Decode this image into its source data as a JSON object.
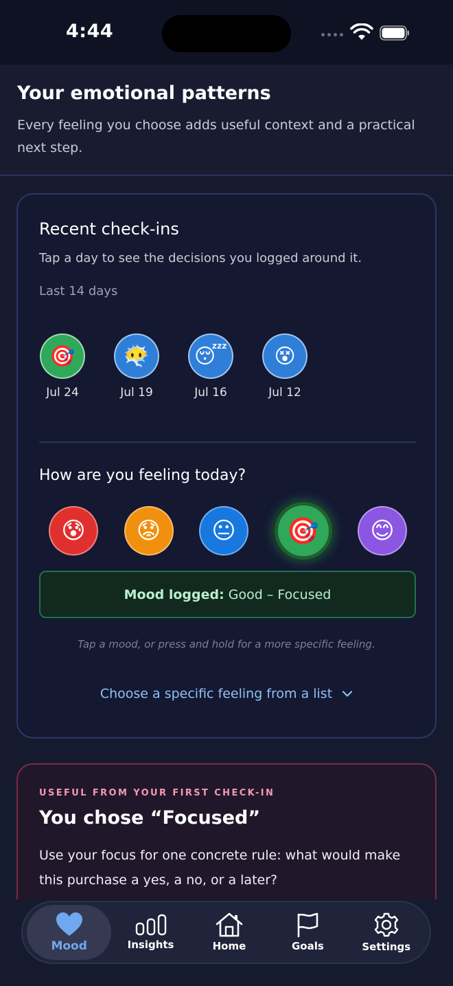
{
  "status_bar": {
    "time": "4:44"
  },
  "header": {
    "title": "Your emotional patterns",
    "subtitle": "Every feeling you choose adds useful context and a practical next step."
  },
  "checkins_card": {
    "title": "Recent check-ins",
    "subtitle": "Tap a day to see the decisions you logged around it.",
    "range_label": "Last 14 days",
    "days": [
      {
        "emoji": "🎯",
        "date": "Jul 24",
        "color": "#2fa85a"
      },
      {
        "emoji": "😶‍🌫️",
        "date": "Jul 19",
        "color": "#2f7fd8"
      },
      {
        "emoji": "😴",
        "date": "Jul 16",
        "color": "#2f7fd8"
      },
      {
        "emoji": "😵",
        "date": "Jul 12",
        "color": "#2f7fd8"
      }
    ],
    "question": "How are you feeling today?",
    "moods": [
      {
        "emoji": "😰",
        "color": "#e0302e"
      },
      {
        "emoji": "😟",
        "color": "#f0900e"
      },
      {
        "emoji": "😐",
        "color": "#1778e0"
      },
      {
        "emoji": "🎯",
        "color": "#2fa85a"
      },
      {
        "emoji": "😊",
        "color": "#8a56e2"
      }
    ],
    "logged_label": "Mood logged:",
    "logged_value": "Good – Focused",
    "hint": "Tap a mood, or press and hold for a more specific feeling.",
    "specific_link": "Choose a specific feeling from a list"
  },
  "insight_card": {
    "eyebrow": "USEFUL FROM YOUR FIRST CHECK-IN",
    "title": "You chose “Focused”",
    "body": "Use your focus for one concrete rule: what would make this purchase a yes, a no, or a later?"
  },
  "tabbar": {
    "items": [
      {
        "label": "Mood",
        "icon": "heart-icon",
        "active": true
      },
      {
        "label": "Insights",
        "icon": "bar-chart-icon",
        "active": false
      },
      {
        "label": "Home",
        "icon": "home-icon",
        "active": false
      },
      {
        "label": "Goals",
        "icon": "flag-icon",
        "active": false
      },
      {
        "label": "Settings",
        "icon": "gear-icon",
        "active": false
      }
    ],
    "active_color": "#6fa8ee"
  }
}
